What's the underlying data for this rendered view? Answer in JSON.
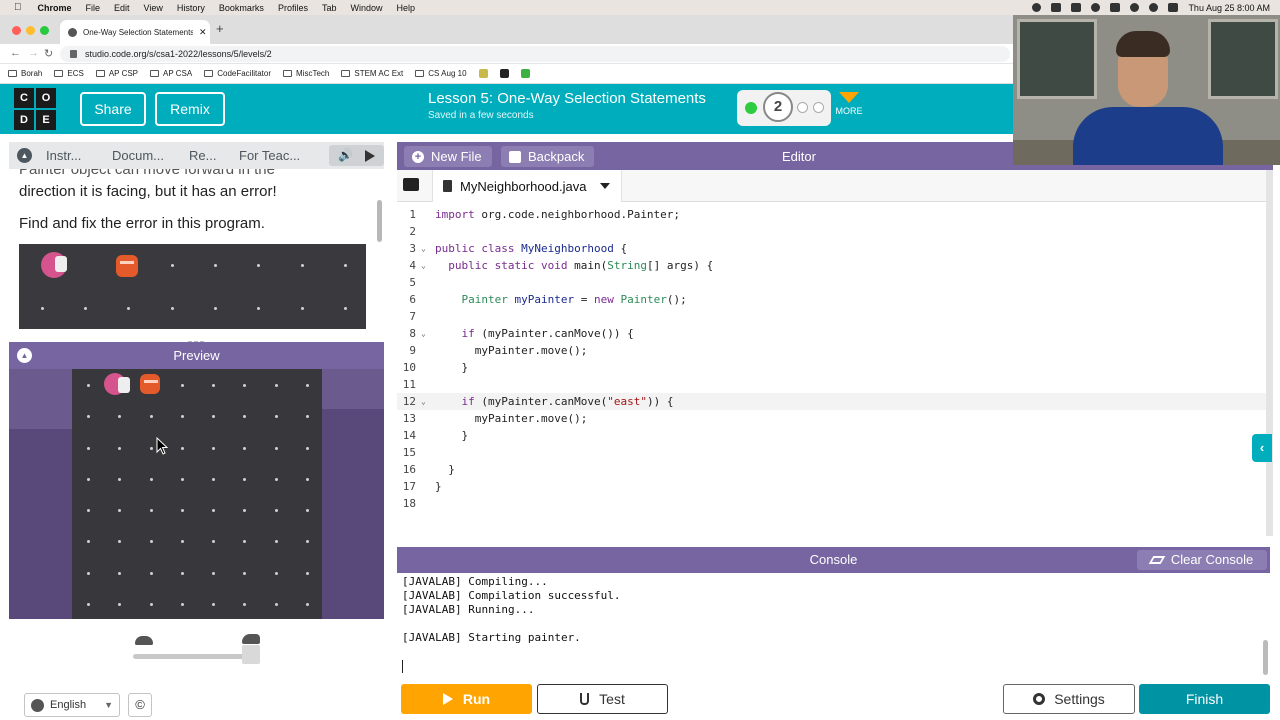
{
  "macos_menubar": {
    "app": "Chrome",
    "items": [
      "File",
      "Edit",
      "View",
      "History",
      "Bookmarks",
      "Profiles",
      "Tab",
      "Window",
      "Help"
    ],
    "clock": "Thu Aug 25  8:00 AM"
  },
  "browser": {
    "tab_title": "One-Way Selection Statements",
    "url": "studio.code.org/s/csa1-2022/lessons/5/levels/2",
    "bookmarks": [
      "Borah",
      "ECS",
      "AP CSP",
      "AP CSA",
      "CodeFacilitator",
      "MiscTech",
      "STEM AC Ext",
      "CS Aug 10"
    ]
  },
  "header": {
    "logo_letters": [
      "C",
      "O",
      "D",
      "E"
    ],
    "share_label": "Share",
    "remix_label": "Remix",
    "lesson_title": "Lesson 5: One-Way Selection Statements",
    "save_status": "Saved in a few seconds",
    "current_level": "2",
    "more_label": "MORE",
    "colors": {
      "teal": "#00adbc",
      "progress_green": "#2ecc40",
      "more_orange": "#ffa400"
    }
  },
  "instructions": {
    "tabs": [
      "Instr...",
      "Docum...",
      "Re...",
      "For Teac..."
    ],
    "text_partial": "Painter object can move forward in the",
    "text_line1": "direction it is facing, but it has an error!",
    "text_line2": "Find and fix the error in this program."
  },
  "preview": {
    "title": "Preview"
  },
  "footer": {
    "language": "English",
    "copyright_symbol": "©"
  },
  "editor": {
    "new_file_label": "New File",
    "backpack_label": "Backpack",
    "title": "Editor",
    "filename": "MyNeighborhood.java",
    "lines": [
      {
        "n": "1",
        "code": "import org.code.neighborhood.Painter;"
      },
      {
        "n": "2",
        "code": ""
      },
      {
        "n": "3",
        "code": "public class MyNeighborhood {"
      },
      {
        "n": "4",
        "code": "  public static void main(String[] args) {"
      },
      {
        "n": "5",
        "code": ""
      },
      {
        "n": "6",
        "code": "    Painter myPainter = new Painter();"
      },
      {
        "n": "7",
        "code": ""
      },
      {
        "n": "8",
        "code": "    if (myPainter.canMove()) {"
      },
      {
        "n": "9",
        "code": "      myPainter.move();"
      },
      {
        "n": "10",
        "code": "    }"
      },
      {
        "n": "11",
        "code": ""
      },
      {
        "n": "12",
        "code": "    if (myPainter.canMove(\"east\")) {"
      },
      {
        "n": "13",
        "code": "      myPainter.move();"
      },
      {
        "n": "14",
        "code": "    }"
      },
      {
        "n": "15",
        "code": ""
      },
      {
        "n": "16",
        "code": "  }"
      },
      {
        "n": "17",
        "code": "}"
      },
      {
        "n": "18",
        "code": ""
      }
    ]
  },
  "console": {
    "title": "Console",
    "clear_label": "Clear Console",
    "output": [
      "[JAVALAB] Compiling...",
      "[JAVALAB] Compilation successful.",
      "[JAVALAB] Running...",
      "",
      "[JAVALAB] Starting painter."
    ]
  },
  "actions": {
    "run_label": "Run",
    "test_label": "Test",
    "settings_label": "Settings",
    "finish_label": "Finish"
  }
}
